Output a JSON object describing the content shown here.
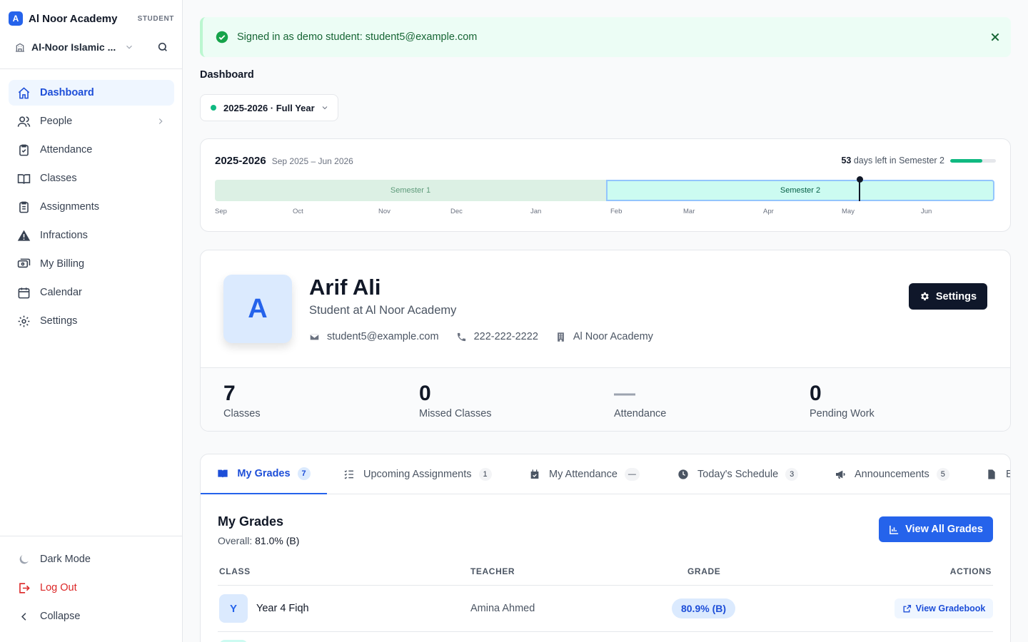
{
  "brand": {
    "logo_letter": "A",
    "name": "Al Noor Academy",
    "role": "STUDENT"
  },
  "school": {
    "name": "Al-Noor Islamic ..."
  },
  "nav": {
    "dashboard": "Dashboard",
    "people": "People",
    "attendance": "Attendance",
    "classes": "Classes",
    "assignments": "Assignments",
    "infractions": "Infractions",
    "billing": "My Billing",
    "calendar": "Calendar",
    "settings": "Settings"
  },
  "bottom_nav": {
    "dark_mode": "Dark Mode",
    "logout": "Log Out",
    "collapse": "Collapse"
  },
  "alert": {
    "text": "Signed in as demo student: student5@example.com"
  },
  "page": {
    "title": "Dashboard"
  },
  "year_select": {
    "value": "2025-2026 · Full Year"
  },
  "timeline": {
    "year": "2025-2026",
    "range": "Sep 2025 – Jun 2026",
    "days_left": "53",
    "days_left_text": "days left in Semester 2",
    "semester_progress": 0.7,
    "semester1": "Semester 1",
    "semester2": "Semester 2",
    "months": [
      "Sep",
      "Oct",
      "Nov",
      "Dec",
      "Jan",
      "Feb",
      "Mar",
      "Apr",
      "May",
      "Jun"
    ]
  },
  "profile": {
    "initial": "A",
    "name": "Arif Ali",
    "subtitle": "Student at Al Noor Academy",
    "email": "student5@example.com",
    "phone": "222-222-2222",
    "school": "Al Noor Academy",
    "settings_label": "Settings"
  },
  "stats": [
    {
      "value": "7",
      "label": "Classes"
    },
    {
      "value": "0",
      "label": "Missed Classes"
    },
    {
      "value": "—",
      "label": "Attendance"
    },
    {
      "value": "0",
      "label": "Pending Work"
    }
  ],
  "tabs": [
    {
      "label": "My Grades",
      "badge": "7"
    },
    {
      "label": "Upcoming Assignments",
      "badge": "1"
    },
    {
      "label": "My Attendance",
      "badge": "—"
    },
    {
      "label": "Today's Schedule",
      "badge": "3"
    },
    {
      "label": "Announcements",
      "badge": "5"
    },
    {
      "label": "Bi"
    }
  ],
  "grades": {
    "title": "My Grades",
    "overall_label": "Overall:",
    "overall_value": "81.0% (B)",
    "view_all_label": "View All Grades",
    "columns": [
      "CLASS",
      "TEACHER",
      "GRADE",
      "ACTIONS"
    ],
    "rows": [
      {
        "initial": "Y",
        "class": "Year 4 Fiqh",
        "teacher": "Amina Ahmed",
        "grade": "80.9% (B)",
        "action": "View Gradebook"
      }
    ]
  },
  "colors": {
    "primary": "#2563eb",
    "success": "#10b981",
    "dark": "#0f172a",
    "danger": "#dc2626"
  }
}
